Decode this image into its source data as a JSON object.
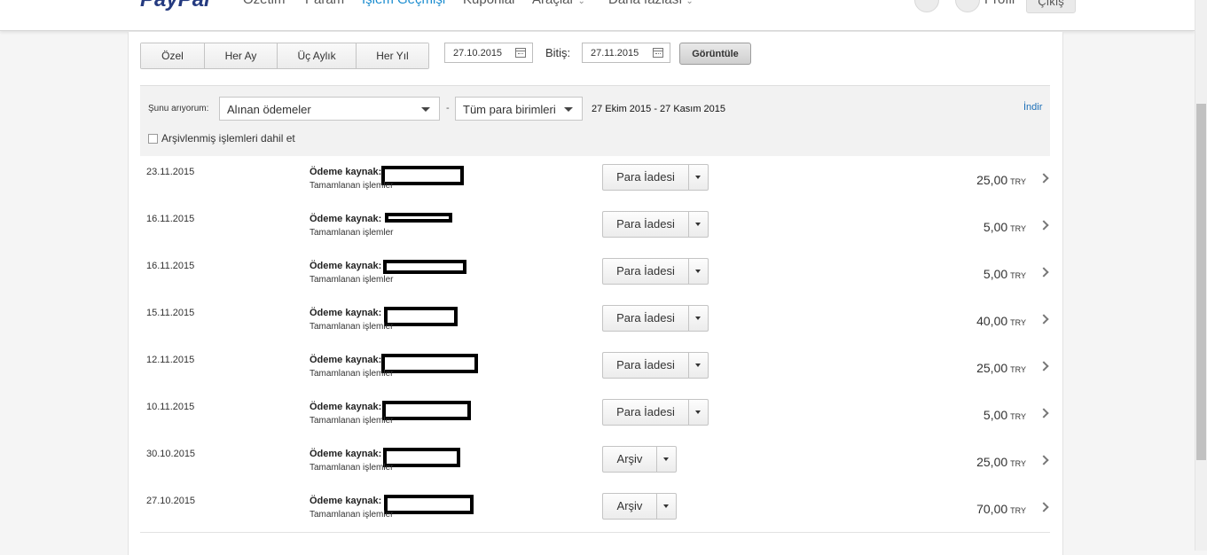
{
  "nav": {
    "logo": "PayPal",
    "items": [
      "Özetim",
      "Param",
      "İşlem Geçmişi",
      "Kuponlar",
      "Araçlar",
      "Daha fazlası"
    ],
    "profile": "Profil",
    "logout": "Çıkış"
  },
  "periods": [
    "Özel",
    "Her Ay",
    "Üç Aylık",
    "Her Yıl"
  ],
  "date_from": "27.10.2015",
  "end_label": "Bitiş:",
  "date_to": "27.11.2015",
  "show_button": "Görüntüle",
  "filter": {
    "search_label": "Şunu arıyorum:",
    "type_select": "Alınan ödemeler",
    "dash": "-",
    "currency_select": "Tüm para birimleri",
    "range": "27 Ekim 2015  -  27 Kasım 2015",
    "download": "İndir",
    "archive_label": "Arşivlenmiş işlemleri dahil et"
  },
  "transactions": [
    {
      "date": "23.11.2015",
      "source_label": "Ödeme kaynak:",
      "status": "Tamamlanan işlemler",
      "action": "Para İadesi",
      "amount": "25,00",
      "currency": "TRY"
    },
    {
      "date": "16.11.2015",
      "source_label": "Ödeme kaynak:",
      "status": "Tamamlanan işlemler",
      "action": "Para İadesi",
      "amount": "5,00",
      "currency": "TRY"
    },
    {
      "date": "16.11.2015",
      "source_label": "Ödeme kaynak:",
      "status": "Tamamlanan işlemler",
      "action": "Para İadesi",
      "amount": "5,00",
      "currency": "TRY"
    },
    {
      "date": "15.11.2015",
      "source_label": "Ödeme kaynak:",
      "status": "Tamamlanan işlemler",
      "action": "Para İadesi",
      "amount": "40,00",
      "currency": "TRY"
    },
    {
      "date": "12.11.2015",
      "source_label": "Ödeme kaynak:",
      "status": "Tamamlanan işlemler",
      "action": "Para İadesi",
      "amount": "25,00",
      "currency": "TRY"
    },
    {
      "date": "10.11.2015",
      "source_label": "Ödeme kaynak:",
      "status": "Tamamlanan işlemler",
      "action": "Para İadesi",
      "amount": "5,00",
      "currency": "TRY"
    },
    {
      "date": "30.10.2015",
      "source_label": "Ödeme kaynak:",
      "status": "Tamamlanan işlemler",
      "action": "Arşiv",
      "amount": "25,00",
      "currency": "TRY"
    },
    {
      "date": "27.10.2015",
      "source_label": "Ödeme kaynak:",
      "status": "Tamamlanan işlemler",
      "action": "Arşiv",
      "amount": "70,00",
      "currency": "TRY"
    }
  ]
}
